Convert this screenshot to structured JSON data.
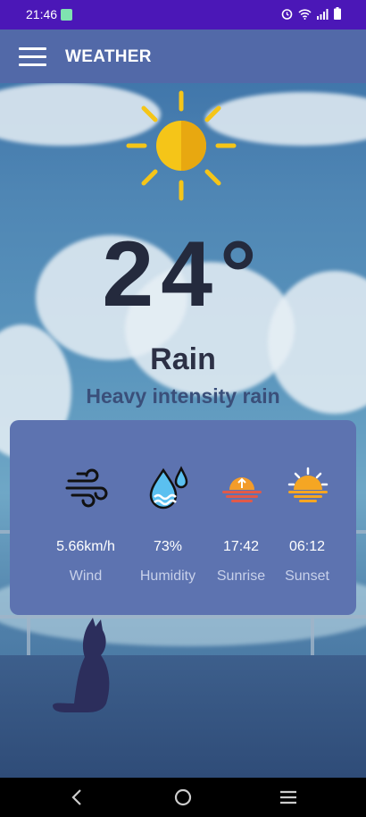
{
  "status_bar": {
    "time": "21:46"
  },
  "app_bar": {
    "title": "WEATHER"
  },
  "weather": {
    "temperature": "24°",
    "condition": "Rain",
    "description": "Heavy intensity rain"
  },
  "stats": [
    {
      "icon": "wind-icon",
      "value": "5.66km/h",
      "label": "Wind"
    },
    {
      "icon": "humidity-icon",
      "value": "73%",
      "label": "Humidity"
    },
    {
      "icon": "sunrise-icon",
      "value": "17:42",
      "label": "Sunrise"
    },
    {
      "icon": "sunset-icon",
      "value": "06:12",
      "label": "Sunset"
    }
  ],
  "colors": {
    "status_bar": "#4b17b7",
    "app_bar": "#5269a8",
    "card": "#5d73b0",
    "sun": "#f5c518"
  }
}
